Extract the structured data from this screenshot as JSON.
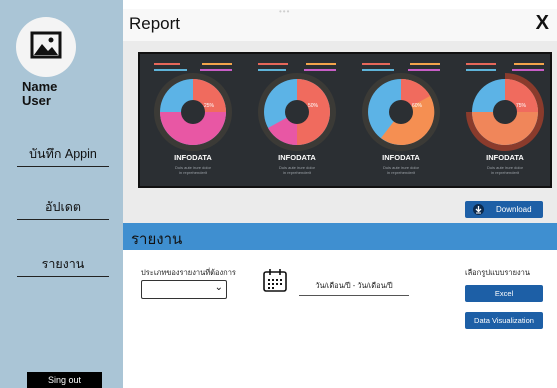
{
  "sidebar": {
    "name_line1": "Name",
    "name_line2": "User",
    "items": [
      "บันทึก Appin",
      "อัปเดต",
      "รายงาน"
    ],
    "signout": "Sing out"
  },
  "header": {
    "title": "Report",
    "close": "X",
    "dots": "•••"
  },
  "dashboard": {
    "cards": [
      {
        "label": "INFODATA",
        "percent": "25%",
        "sub1": "Duis aute irure dolor",
        "sub2": "in reprehenderit"
      },
      {
        "label": "INFODATA",
        "percent": "50%",
        "sub1": "Duis aute irure dolor",
        "sub2": "in reprehenderit"
      },
      {
        "label": "INFODATA",
        "percent": "60%",
        "sub1": "Duis aute irure dolor",
        "sub2": "in reprehenderit"
      },
      {
        "label": "INFODATA",
        "percent": "75%",
        "sub1": "Duis aute irure dolor",
        "sub2": "in reprehenderit"
      }
    ]
  },
  "download_label": "Download",
  "report": {
    "title": "รายงาน",
    "select_label": "ประเภทของรายงานที่ต้องการ",
    "select_value": "",
    "date_range": "วัน/เดือน/ปี - วัน/เดือน/ปี",
    "format_label": "เลือกรูปแบบรายงาน",
    "excel": "Excel",
    "dataviz": "Data Visualization"
  }
}
